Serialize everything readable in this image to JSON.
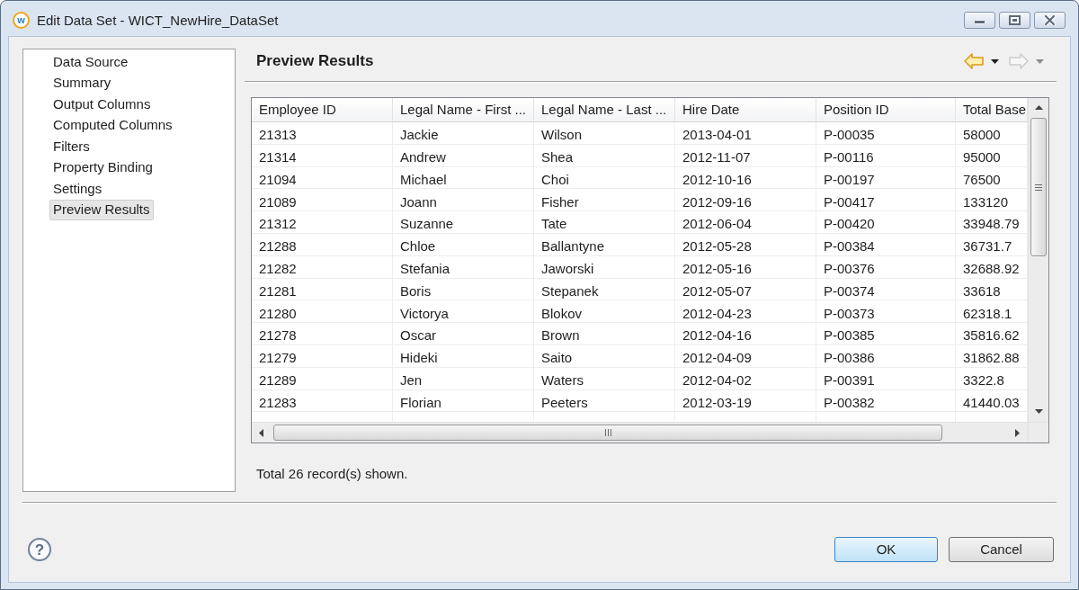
{
  "window": {
    "logo": "w",
    "title": "Edit Data Set - WICT_NewHire_DataSet"
  },
  "sidebar": {
    "items": [
      {
        "label": "Data Source",
        "selected": false
      },
      {
        "label": "Summary",
        "selected": false
      },
      {
        "label": "Output Columns",
        "selected": false
      },
      {
        "label": "Computed Columns",
        "selected": false
      },
      {
        "label": "Filters",
        "selected": false
      },
      {
        "label": "Property Binding",
        "selected": false
      },
      {
        "label": "Settings",
        "selected": false
      },
      {
        "label": "Preview Results",
        "selected": true
      }
    ]
  },
  "page": {
    "title": "Preview Results"
  },
  "history": {
    "back": {
      "disabled": false
    },
    "forward": {
      "disabled": true
    }
  },
  "table": {
    "columns": [
      "Employee ID",
      "Legal Name - First ...",
      "Legal Name - Last ...",
      "Hire Date",
      "Position ID",
      "Total Base"
    ],
    "rows": [
      [
        "21313",
        "Jackie",
        "Wilson",
        "2013-04-01",
        "P-00035",
        "58000"
      ],
      [
        "21314",
        "Andrew",
        "Shea",
        "2012-11-07",
        "P-00116",
        "95000"
      ],
      [
        "21094",
        "Michael",
        "Choi",
        "2012-10-16",
        "P-00197",
        "76500"
      ],
      [
        "21089",
        "Joann",
        "Fisher",
        "2012-09-16",
        "P-00417",
        "133120"
      ],
      [
        "21312",
        "Suzanne",
        "Tate",
        "2012-06-04",
        "P-00420",
        "33948.79"
      ],
      [
        "21288",
        "Chloe",
        "Ballantyne",
        "2012-05-28",
        "P-00384",
        "36731.7"
      ],
      [
        "21282",
        "Stefania",
        "Jaworski",
        "2012-05-16",
        "P-00376",
        "32688.92"
      ],
      [
        "21281",
        "Boris",
        "Stepanek",
        "2012-05-07",
        "P-00374",
        "33618"
      ],
      [
        "21280",
        "Victorya",
        "Blokov",
        "2012-04-23",
        "P-00373",
        "62318.1"
      ],
      [
        "21278",
        "Oscar",
        "Brown",
        "2012-04-16",
        "P-00385",
        "35816.62"
      ],
      [
        "21279",
        "Hideki",
        "Saito",
        "2012-04-09",
        "P-00386",
        "31862.88"
      ],
      [
        "21289",
        "Jen",
        "Waters",
        "2012-04-02",
        "P-00391",
        "3322.8"
      ],
      [
        "21283",
        "Florian",
        "Peeters",
        "2012-03-19",
        "P-00382",
        "41440.03"
      ]
    ]
  },
  "status": "Total 26 record(s) shown.",
  "help": {
    "label": "?"
  },
  "buttons": [
    {
      "label": "OK",
      "default": true
    },
    {
      "label": "Cancel",
      "default": false
    }
  ]
}
